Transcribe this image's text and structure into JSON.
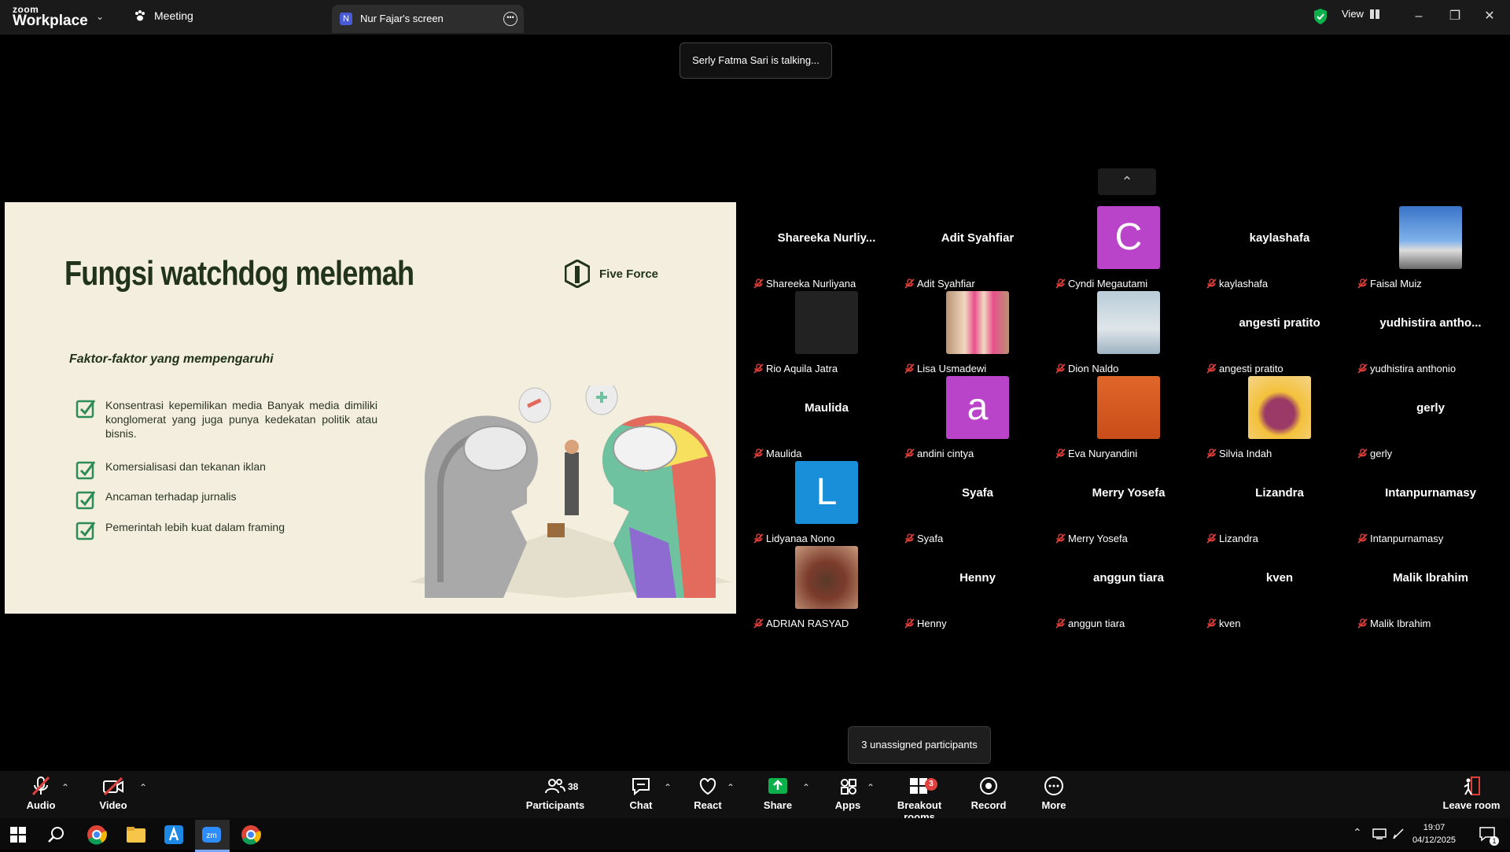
{
  "app": {
    "logo_small": "zoom",
    "logo_big": "Workplace"
  },
  "tabs": {
    "meeting": "Meeting",
    "screen_badge": "N",
    "screen": "Nur Fajar's screen"
  },
  "header": {
    "view": "View"
  },
  "banner": {
    "talking": "Serly Fatma Sari is talking..."
  },
  "slide": {
    "title": "Fungsi watchdog melemah",
    "brand": "Five Force",
    "subtitle": "Faktor-faktor yang mempengaruhi",
    "bullets": [
      "Konsentrasi kepemilikan media Banyak media dimiliki konglomerat yang juga punya kedekatan politik atau bisnis.",
      "Komersialisasi dan tekanan iklan",
      "Ancaman terhadap jurnalis",
      "Pemerintah lebih kuat dalam framing"
    ]
  },
  "participants": [
    {
      "label": "Shareeka Nurliyana",
      "center": "Shareeka  Nurliy..."
    },
    {
      "label": "Adit Syahfiar",
      "center": "Adit Syahfiar"
    },
    {
      "label": "Cyndi Megautami",
      "letter": "C",
      "color": "#b944c9"
    },
    {
      "label": "kaylashafa",
      "center": "kaylashafa"
    },
    {
      "label": "Faisal Muiz",
      "photo": "mountain"
    },
    {
      "label": "Rio Aquila Jatra",
      "photo": "dark"
    },
    {
      "label": "Lisa Usmadewi",
      "photo": "pink"
    },
    {
      "label": "Dion Naldo",
      "photo": "beach"
    },
    {
      "label": "angesti pratito",
      "center": "angesti pratito"
    },
    {
      "label": "yudhistira anthonio",
      "center": "yudhistira  antho..."
    },
    {
      "label": "Maulida",
      "center": "Maulida"
    },
    {
      "label": "andini cintya",
      "letter": "a",
      "color": "#b944c9"
    },
    {
      "label": "Eva Nuryandini",
      "photo": "orange"
    },
    {
      "label": "Silvia Indah",
      "photo": "fruit"
    },
    {
      "label": "gerly",
      "center": "gerly"
    },
    {
      "label": "Lidyanaa Nono",
      "letter": "L",
      "color": "#1a8fd9"
    },
    {
      "label": "Syafa",
      "center": "Syafa"
    },
    {
      "label": "Merry Yosefa",
      "center": "Merry Yosefa"
    },
    {
      "label": "Lizandra",
      "center": "Lizandra"
    },
    {
      "label": "Intanpurnamasy",
      "center": "Intanpurnamasy"
    },
    {
      "label": "ADRIAN RASYAD",
      "photo": "man"
    },
    {
      "label": "Henny",
      "center": "Henny"
    },
    {
      "label": "anggun tiara",
      "center": "anggun tiara"
    },
    {
      "label": "kven",
      "center": "kven"
    },
    {
      "label": "Malik Ibrahim",
      "center": "Malik Ibrahim"
    }
  ],
  "tooltip": {
    "unassigned": "3 unassigned participants"
  },
  "toolbar": {
    "audio": "Audio",
    "video": "Video",
    "participants": "Participants",
    "participants_count": "38",
    "chat": "Chat",
    "react": "React",
    "share": "Share",
    "apps": "Apps",
    "breakout": "Breakout rooms",
    "breakout_badge": "3",
    "record": "Record",
    "more": "More",
    "leave": "Leave room"
  },
  "taskbar": {
    "time": "19:07",
    "date": "04/12/2025",
    "notif_count": "1"
  },
  "colors": {
    "accent_green": "#0bb04b",
    "slide_bg": "#f3eedd",
    "slide_text": "#22331c",
    "mute_red": "#e0413c"
  }
}
